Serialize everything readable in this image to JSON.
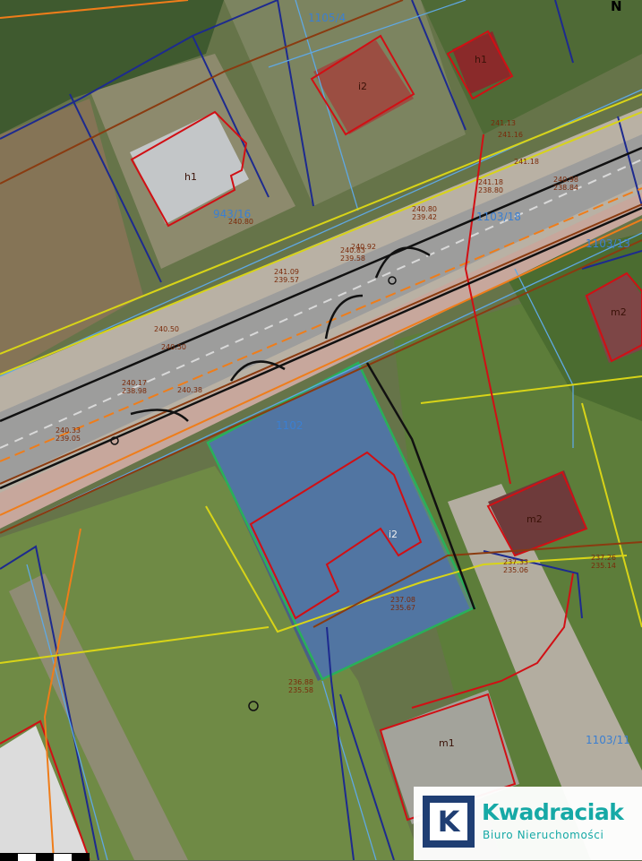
{
  "parcels": {
    "main": "1102",
    "road_west": "943/16",
    "north": "1105/4",
    "north_east": "1103/18",
    "east": "1103/13",
    "south_east": "1103/11"
  },
  "buildings": {
    "b_nw": "h1",
    "b_n": "i2",
    "b_ne": "h1",
    "b_main": "i2",
    "b_e": "m2",
    "b_se": "m2",
    "b_s": "m1"
  },
  "elevations": [
    "240.80",
    "240.92",
    "241.13",
    "241.16",
    "241.18",
    "241.18\n238.80",
    "240.98\n238.84",
    "240.80\n239.42",
    "240.83\n239.58",
    "240.50",
    "240.50",
    "240.17\n238.98",
    "240.38",
    "240.33\n239.05",
    "237.08\n235.67",
    "236.88\n235.58",
    "237.33\n235.06",
    "237.26\n235.14",
    "241.09\n239.57"
  ],
  "logo": {
    "mark": "K",
    "name": "Kwadraciak",
    "subtitle": "Biuro Nieruchomości"
  },
  "north_arrow": "N",
  "colors": {
    "parcel_boundary": "#1d2a8f",
    "building_outline": "#d10f14",
    "utility_orange": "#ef7d1a",
    "utility_yellow": "#d8d418",
    "utility_brown": "#8a3b10",
    "highlight": "#29b05a",
    "logo_text": "#16a9a6",
    "logo_mark": "#1f3e73"
  }
}
